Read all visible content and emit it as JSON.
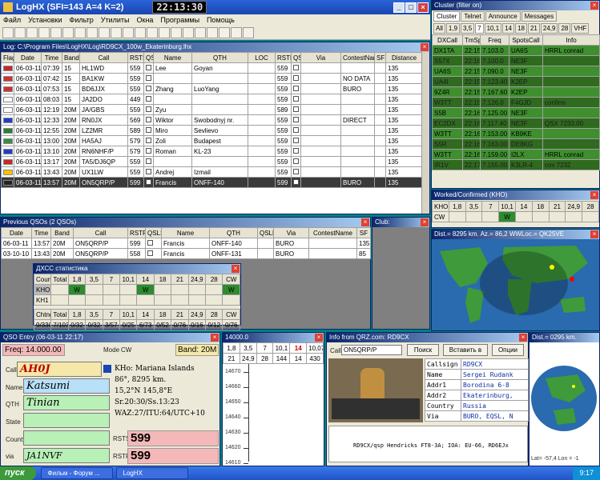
{
  "app": {
    "title": "LogHX (SFI=143 A=4 K=2)",
    "clock": "22:13:30"
  },
  "menu": [
    "Файл",
    "Установки",
    "Фильтр",
    "Утилиты",
    "Окна",
    "Программы",
    "Помощь"
  ],
  "log": {
    "title": "Log: C:\\Program Files\\LogHX\\Log\\RD9CX_100w_Ekaterinburg.lhx",
    "columns": [
      "Flag",
      "Date",
      "Time",
      "Band",
      "Call",
      "RSTS",
      "QSL S",
      "Name",
      "QTH",
      "LOC",
      "RSTR",
      "QSL R",
      "Via",
      "ContestName",
      "SFI",
      "Distance"
    ],
    "rows": [
      [
        "06-03-11",
        "07:39",
        "15",
        "HL1WD",
        "559",
        "Lee",
        "Goyan",
        "",
        "559",
        "",
        "",
        "",
        "135",
        "5198,4 km."
      ],
      [
        "06-03-11",
        "07:42",
        "15",
        "BA1KW",
        "559",
        "",
        "",
        "",
        "559",
        "",
        "NO DATA",
        "",
        "135",
        "4361,7 km."
      ],
      [
        "06-03-11",
        "07:53",
        "15",
        "BD6JJX",
        "559",
        "Zhang",
        "LuoYang",
        "",
        "559",
        "",
        "BURO",
        "",
        "135",
        "4361,7 km."
      ],
      [
        "06-03-11",
        "08:03",
        "15",
        "JA2DO",
        "449",
        "",
        "",
        "",
        "559",
        "",
        "",
        "",
        "135",
        "6012,1 km."
      ],
      [
        "06-03-11",
        "12:19",
        "20M",
        "JA/GBS",
        "559",
        "Zyu",
        "",
        "",
        "589",
        "",
        "",
        "",
        "135",
        "5887,6 km."
      ],
      [
        "06-03-11",
        "12:33",
        "20M",
        "RN0JX",
        "569",
        "Wiktor",
        "Swobodnyj nr.",
        "",
        "559",
        "",
        "DIRECT",
        "",
        "135",
        "4300,6 km."
      ],
      [
        "06-03-11",
        "12:55",
        "20M",
        "LZ2MR",
        "589",
        "Miro",
        "Sevlievo",
        "",
        "559",
        "",
        "",
        "",
        "135",
        "2902,9 km."
      ],
      [
        "06-03-11",
        "13:00",
        "20M",
        "HA5AJ",
        "579",
        "Zoli",
        "Budapest",
        "",
        "559",
        "",
        "",
        "",
        "135",
        "2966,1 km."
      ],
      [
        "06-03-11",
        "13:10",
        "20M",
        "RN6NHF/P",
        "579",
        "Roman",
        "KL-23",
        "",
        "559",
        "",
        "",
        "",
        "135",
        "1580,7 km."
      ],
      [
        "06-03-11",
        "13:17",
        "20M",
        "TA5/DJ6QP",
        "559",
        "",
        "",
        "",
        "559",
        "",
        "",
        "",
        "135",
        "2946,0 km."
      ],
      [
        "06-03-11",
        "13:43",
        "20M",
        "UX1LW",
        "559",
        "Andrej",
        "Izmail",
        "",
        "559",
        "",
        "",
        "",
        "135",
        "2464,0 km."
      ],
      [
        "06-03-11",
        "13:57",
        "20M",
        "ON5QRP/P",
        "599",
        "Francis",
        "ONFF-140",
        "",
        "599",
        "",
        "BURO",
        "",
        "135",
        "3640,6 km."
      ]
    ]
  },
  "cluster": {
    "title": "Cluster (filter on)",
    "tabs": [
      "Cluster",
      "Telnet",
      "Announce",
      "Messages"
    ],
    "bands": [
      "All",
      "1,9",
      "3,5",
      "7",
      "10,1",
      "14",
      "18",
      "21",
      "24,9",
      "28",
      "VHF"
    ],
    "columns": [
      "DXCall",
      "TmSp",
      "Freq",
      "SpotsCall",
      "Info"
    ],
    "rows": [
      [
        "DX1TA",
        "22:15",
        "7.103.0",
        "UA6S",
        "HRRL conrad"
      ],
      [
        "S57X",
        "22:16",
        "7.100.0",
        "NE3F",
        ""
      ],
      [
        "UA6S",
        "22:15",
        "7.090.0",
        "NE3F",
        ""
      ],
      [
        "UA4I",
        "22:15",
        "7.123.40",
        "K2EP",
        ""
      ],
      [
        "9Z4R",
        "22:15",
        "7.167.60",
        "K2EP",
        ""
      ],
      [
        "W3TT",
        "22:15",
        "7.126.0",
        "F4GJD",
        "confirm"
      ],
      [
        "S5B",
        "22:16",
        "7.125.00",
        "NE3F",
        ""
      ],
      [
        "EC2DX",
        "22:16",
        "7.117.40",
        "NE3F",
        "QSX 7233.00"
      ],
      [
        "W3TT",
        "22:16",
        "7.153.00",
        "KB9KE",
        ""
      ],
      [
        "S5R",
        "22:16",
        "7.163.00",
        "DE8KG",
        ""
      ],
      [
        "W3TT",
        "22:16",
        "7.159.00",
        "I2LX",
        "HRRL conrad"
      ],
      [
        "IR1V",
        "22:17",
        "7.155.00",
        "K3LR-4",
        "cov 7232"
      ]
    ]
  },
  "worked": {
    "title": "Worked/Confirmed (KHO)",
    "bands": [
      "KHO",
      "1,8",
      "3,5",
      "7",
      "10,1",
      "14",
      "18",
      "21",
      "24,9",
      "28"
    ],
    "cw": "CW",
    "mark": "W"
  },
  "prev": {
    "title": "Previous QSOs (2 QSOs)",
    "columns": [
      "Date",
      "Time",
      "Band",
      "Call",
      "RSTR",
      "QSLS",
      "Name",
      "QTH",
      "QSLR",
      "Via",
      "ContestName",
      "SF"
    ],
    "rows": [
      [
        "06-03-11",
        "13:57",
        "20M",
        "ON5QRP/P",
        "599",
        "Francis",
        "ONFF-140",
        "",
        "BURO",
        "",
        "135"
      ],
      [
        "03-10-10",
        "13:43",
        "20M",
        "ON5QRP/P",
        "558",
        "Francis",
        "ONFF-131",
        "",
        "BURO",
        "",
        "85"
      ]
    ]
  },
  "dxcc": {
    "title": "ДХСС статистика",
    "cols": [
      "Country",
      "Total",
      "1,8",
      "3,5",
      "7",
      "10,1",
      "14",
      "18",
      "21",
      "24,9",
      "28",
      "CW"
    ],
    "rows": [
      "KHO",
      "KH1"
    ],
    "mark": "W",
    "summary_head": [
      "Chtng",
      "Total",
      "1,8",
      "3,5",
      "7",
      "10,1",
      "14",
      "18",
      "21",
      "24,9",
      "28",
      "CW"
    ],
    "summary": [
      "9/330",
      "7/103",
      "0/32",
      "0/32",
      "3/57",
      "0/25",
      "6/73",
      "0/52",
      "0/76",
      "0/16",
      "0/12",
      "0/76"
    ]
  },
  "club": {
    "title": "Club:"
  },
  "map": {
    "title": "Dist.= 8295 km.   Az.= 86,2   WWLoc.= QK25VE"
  },
  "entry": {
    "title": "QSO Entry (06-03-11 22:17)",
    "freq_label": "Freq:",
    "freq": "14.000.00",
    "mode_label": "Mode",
    "mode": "CW",
    "band_label": "Band:",
    "band": "20M",
    "call_label": "Call",
    "call": "AH0J",
    "name_label": "Name",
    "name": "Katsumi",
    "qth_label": "QTH",
    "qth": "Tinian",
    "state_label": "State",
    "county_label": "County",
    "via_label": "via",
    "via": "JA1NVF",
    "info": [
      "KHo: Mariana Islands",
      "86°, 8295 km.",
      "15,2°N 145,8°E",
      "Sr.20:30/Ss.13:23",
      "WAZ:27/ITU:64/UTC+10"
    ],
    "rsts_label": "RSTS",
    "rsts": "599",
    "rstr_label": "RSTR",
    "rstr": "599"
  },
  "bandmap": {
    "title": "14000.0",
    "bands": [
      "1,8",
      "3,5",
      "7",
      "10,1",
      "14",
      "10,07"
    ],
    "bands2": [
      "21",
      "24,9",
      "28",
      "144",
      "14",
      "430"
    ],
    "freqs": [
      "14670",
      "14660",
      "14650",
      "14640",
      "14630",
      "14620",
      "14610"
    ]
  },
  "qrz": {
    "title": "Info from QRZ.com: RD9CX",
    "call_label": "Call",
    "call": "ON5QRP/P",
    "search": "Поиск",
    "insert": "Вставить в лог",
    "options": "Опции",
    "fields": [
      [
        "Callsign",
        "RD9CX"
      ],
      [
        "Name",
        "Sergei Rudank"
      ],
      [
        "Addr1",
        "Borodina 6-8"
      ],
      [
        "Addr2",
        "Ekaterinburg,"
      ],
      [
        "Country",
        "Russia"
      ],
      [
        "Via",
        "BURO, EQSL, N"
      ]
    ],
    "bio": "RD9CX/qsp Hendricks FT8-3A; IOA: EU-66, RD6EJx"
  },
  "dist2": {
    "title": "Dist.= 0295 km.",
    "footer": "Lat= -57,4 Lon = -1"
  },
  "taskbar": {
    "start": "пуск",
    "items": [
      "Фильм - Форум ...",
      "LogHX"
    ],
    "time": "9:17"
  }
}
